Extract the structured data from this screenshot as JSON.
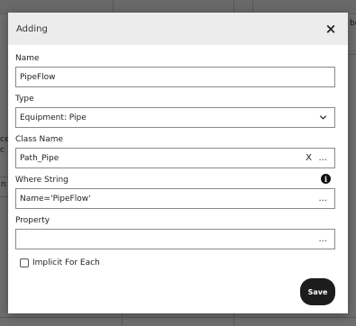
{
  "background": {
    "fragment_1": "ce",
    "fragment_2": "c",
    "fragment_3": "n",
    "fragment_4": "be"
  },
  "dialog": {
    "title": "Adding",
    "close_label": "×"
  },
  "fields": {
    "name": {
      "label": "Name",
      "value": "PipeFlow"
    },
    "type": {
      "label": "Type",
      "value": "Equipment: Pipe"
    },
    "class_name": {
      "label": "Class Name",
      "value": "Path_Pipe",
      "clear": "X",
      "browse": "..."
    },
    "where_string": {
      "label": "Where String",
      "value": "Name='PipeFlow'",
      "browse": "...",
      "info": "i"
    },
    "property": {
      "label": "Property",
      "value": "",
      "browse": "..."
    }
  },
  "checkbox": {
    "label": "Implicit For Each",
    "checked": false
  },
  "save_label": "Save",
  "colors": {
    "save_button": "#1c1c1c",
    "header": "#ececec",
    "overlay": "#6b6b6b"
  },
  "icons": {
    "close": "close-icon",
    "dropdown": "chevron-down-icon",
    "info": "info-icon"
  }
}
